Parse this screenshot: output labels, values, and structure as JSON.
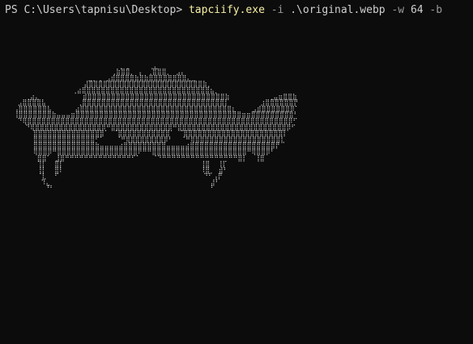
{
  "colors": {
    "background": "#0c0c0c",
    "prompt": "#d0d0d0",
    "executable": "#f9f1a5",
    "flag": "#9a9a9a",
    "art": "#d4d4d4"
  },
  "terminal": {
    "prompt": "PS C:\\Users\\tapnisu\\Desktop> ",
    "executable": "tapciify.exe",
    "args": [
      {
        "type": "flag",
        "text": " -i "
      },
      {
        "type": "arg",
        "text": ".\\original.webp"
      },
      {
        "type": "flag",
        "text": " -w "
      },
      {
        "type": "num",
        "text": "64"
      },
      {
        "type": "flag",
        "text": " -b"
      }
    ]
  },
  "art": {
    "lines": [
      "                                                                ",
      "                           ⠀⡀⢀     ⢀⣄                           ",
      "                          ⢀⣷⣿⣿⡀ ⡄ ⢀⣿⣿⣿⡀⠀⣠⡄                      ",
      "                    ⣀⡀⢀ ⣠⣾⣿⣿⣿⣿⣷⣿⣷⣿⣿⣿⣿⣿⣿⣿⣿⣄⣀                      ",
      "                   ⣼⣿⣿⣿⣿⣿⣿⣿⣿⣿⣿⣿⣿⣿⣿⣿⣿⣿⣿⣿⣿⣿⣿⣿⣿⣷⡀                    ",
      "                ⢀⣴⣿⣿⣿⣿⣿⣿⣿⣿⣿⣿⣿⣿⣿⣿⣿⣿⣿⣿⣿⣿⣿⣿⣿⣿⣿⣿⣿⣦⡀                 ",
      "    ⢀⣴⣄           ⣾⣿⣿⣿⣿⣿⣿⣿⣿⣿⣿⣿⣿⣿⣿⣿⣿⣿⣿⣿⣿⣿⣿⣿⣿⣿⣿⣿⣿⣿⣷          ⢀⣤⣶⣿⣿⣷ ",
      "  ⣠⣿⣿⣿⣿⣧        ⢀⣿⣿⣿⣿⣿⣿⣿⣿⣿⣿⣿⣿⣿⣿⣿⣿⣿⣿⣿⣿⣿⣿⣿⣿⣿⣿⣿⣿⣿⣿⡇        ⣰⣿⣿⣿⣿⣿⣿⡟ ",
      " ⢠⣿⣿⣿⣿⣿⣿⣧      ⣴⣿⣿⣿⣿⣿⣿⣿⣿⣿⣿⣿⣿⣿⣿⣿⣿⣿⣿⣿⣿⣿⣿⣿⣿⣿⣿⣿⣿⣿⣿⣿⣿⣆    ⣠⣾⣿⣿⣿⣿⣿⣿⡿⠁  ",
      " ⢸⣿⣿⣿⣿⣿⣿⣿⣷⣤⣤⣤⣶⣿⣿⣿⣿⣿⣿⣿⣿⣿⣿⣿⣿⣿⣿⣿⣿⣿⣿⣿⣿⣿⣿⣿⣿⣿⣿⣿⣿⣿⣿⣿⣿⣿⣿⣿⣶⣶⣿⣿⣿⣿⣿⣿⣿⣿⣿⠃   ",
      "  ⠙⢿⣿⣿⣿⣿⣿⣿⣿⣿⣿⣿⣿⣿⣿⣿⣿⣿⣿⣿⣿⣿⣿⣿⣿⣿⣿⣿⣿⣿⣿⣿⣿⣿⣿⣿⣿⣿⣿⣿⣿⣿⣿⣿⣿⣿⣿⣿⣿⣿⣿⣿⣿⣿⣿⣿⣿⡿⠋    ",
      "    ⠙⢿⣿⣿⣿⣿⣿⣿⣿⣿⣿⣿⣿⣿⣿⣿⡿⠛⣿⣿⣿⣿⣿⣿⣿⣿⣿⣿⣿⣿⡿⠛⣿⣿⣿⣿⣿⣿⣿⣿⣿⣿⣿⣿⣿⣿⣿⣿⣿⣿⣿⣿⣿⣿⣿⡿⠋      ",
      "      ⣿⣿⣿⣿⣿⣿⣿⣿⣿⣿⣿⣿⣿⣿⣿⠁ ⠈⣿⣿⣿⣿⣿⣿⣿⣿⣿⣿⣿⠁ ⠈⣿⣿⣿⣿⣿⣿⣿⣿⣿⣿⣿⣿⣿⣿⣿⣿⣿⣿⣿⣿⣿⡇       ",
      "      ⣿⣿⣿⣿⣿⣿⣿⣿⣿⣿⣿⣿⣿⠋⠁   ⠈⠛⢿⣿⣿⣿⣿⣿⣿⣿⡿⠃  ⠈⠛⢿⣿⣿⣿⣿⣿⣿⣿⣿⣿⣿⣿⣿⣿⣿⣿⣿⣿⣿⣇       ",
      "      ⣿⣿⣿⣿⣿⣿⣿⣿⣿⣿⣿⣿⣿⣷⣤⣤⣤⣤⣴⣿⣿⣿⣿⣿⣿⣿⣿⣿⣤⣤⣤⣤⣴⣿⣿⣿⣿⣿⣿⣿⣿⣿⣿⣿⣿⣿⣿⣿⣿⣿⣿⡟       ",
      "      ⢿⣿⣿⡿⠛⣿⣿⣿⣿⣿⣿⣿⣿⣿⣿⣿⣿⣿⣿⣿⣿⣿⠟⠛⠛⣿⣿⣿⣿⣿⣿⣿⣿⣿⣿⣿⣿⣿⣿⣿⣿⣿⣿⣿⣿⠛⢿⣿⣿⡿⠃       ",
      "       ⣿⣿⠁ ⣸⣿⠛⠛⠛⠛⠛⠛⠛⠛⠛⠛⠛⠛⠛⠛⠋⠁   ⠈⠙⠛⠛⠛⠛⠛⠛⠛⠛⠛⠛⠛⠛⠛⠛⠛⠛⣿⡇  ⢸⣿         ",
      "       ⢹⡇  ⣿⡇                                   ⢸⣿  ⢸⡏          ",
      "       ⢸⡇  ⣿⠇                                   ⠸⣿⡀ ⣾⠃          ",
      "       ⠈⣇  ⠋                                     ⠙⠃⢠⡟           ",
      "        ⠹⣄                                         ⣼⠃           ",
      "         ⠘⠃                                        ⠃            "
    ]
  }
}
